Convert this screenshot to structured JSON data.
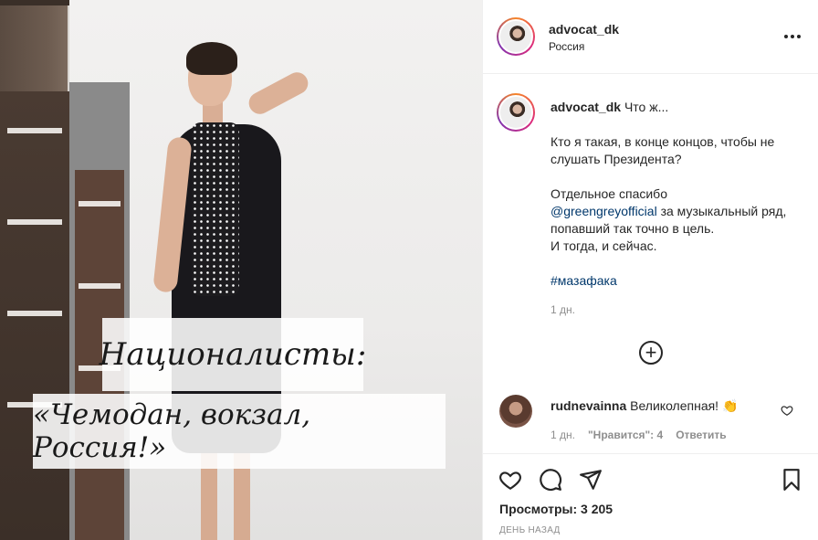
{
  "media": {
    "caption_line_1": "Националисты:",
    "caption_line_2": "«Чемодан, вокзал, Россия!»"
  },
  "header": {
    "username": "advocat_dk",
    "location": "Россия",
    "more_icon": "more-dots-icon"
  },
  "caption": {
    "username": "advocat_dk",
    "intro": "Что ж...",
    "para1": "Кто я такая, в конце концов, чтобы не слушать Президента?",
    "para2_prefix": "Отдельное спасибо",
    "mention": "@greengreyofficial",
    "para2_suffix": "за музыкальный ряд, попавший так точно в цель.",
    "para2_end": "И тогда, и сейчас.",
    "hashtag": "#мазафака",
    "age": "1 дн."
  },
  "load_more_icon": "plus-circle-icon",
  "comment": {
    "username": "rudnevainna",
    "text": "Великолепная! 👏",
    "age": "1 дн.",
    "likes": "\"Нравится\": 4",
    "reply": "Ответить"
  },
  "actions": {
    "like_icon": "heart-icon",
    "comment_icon": "comment-icon",
    "share_icon": "paper-plane-icon",
    "save_icon": "bookmark-icon"
  },
  "stats": {
    "views": "Просмотры: 3 205",
    "date": "ДЕНЬ НАЗАД"
  }
}
